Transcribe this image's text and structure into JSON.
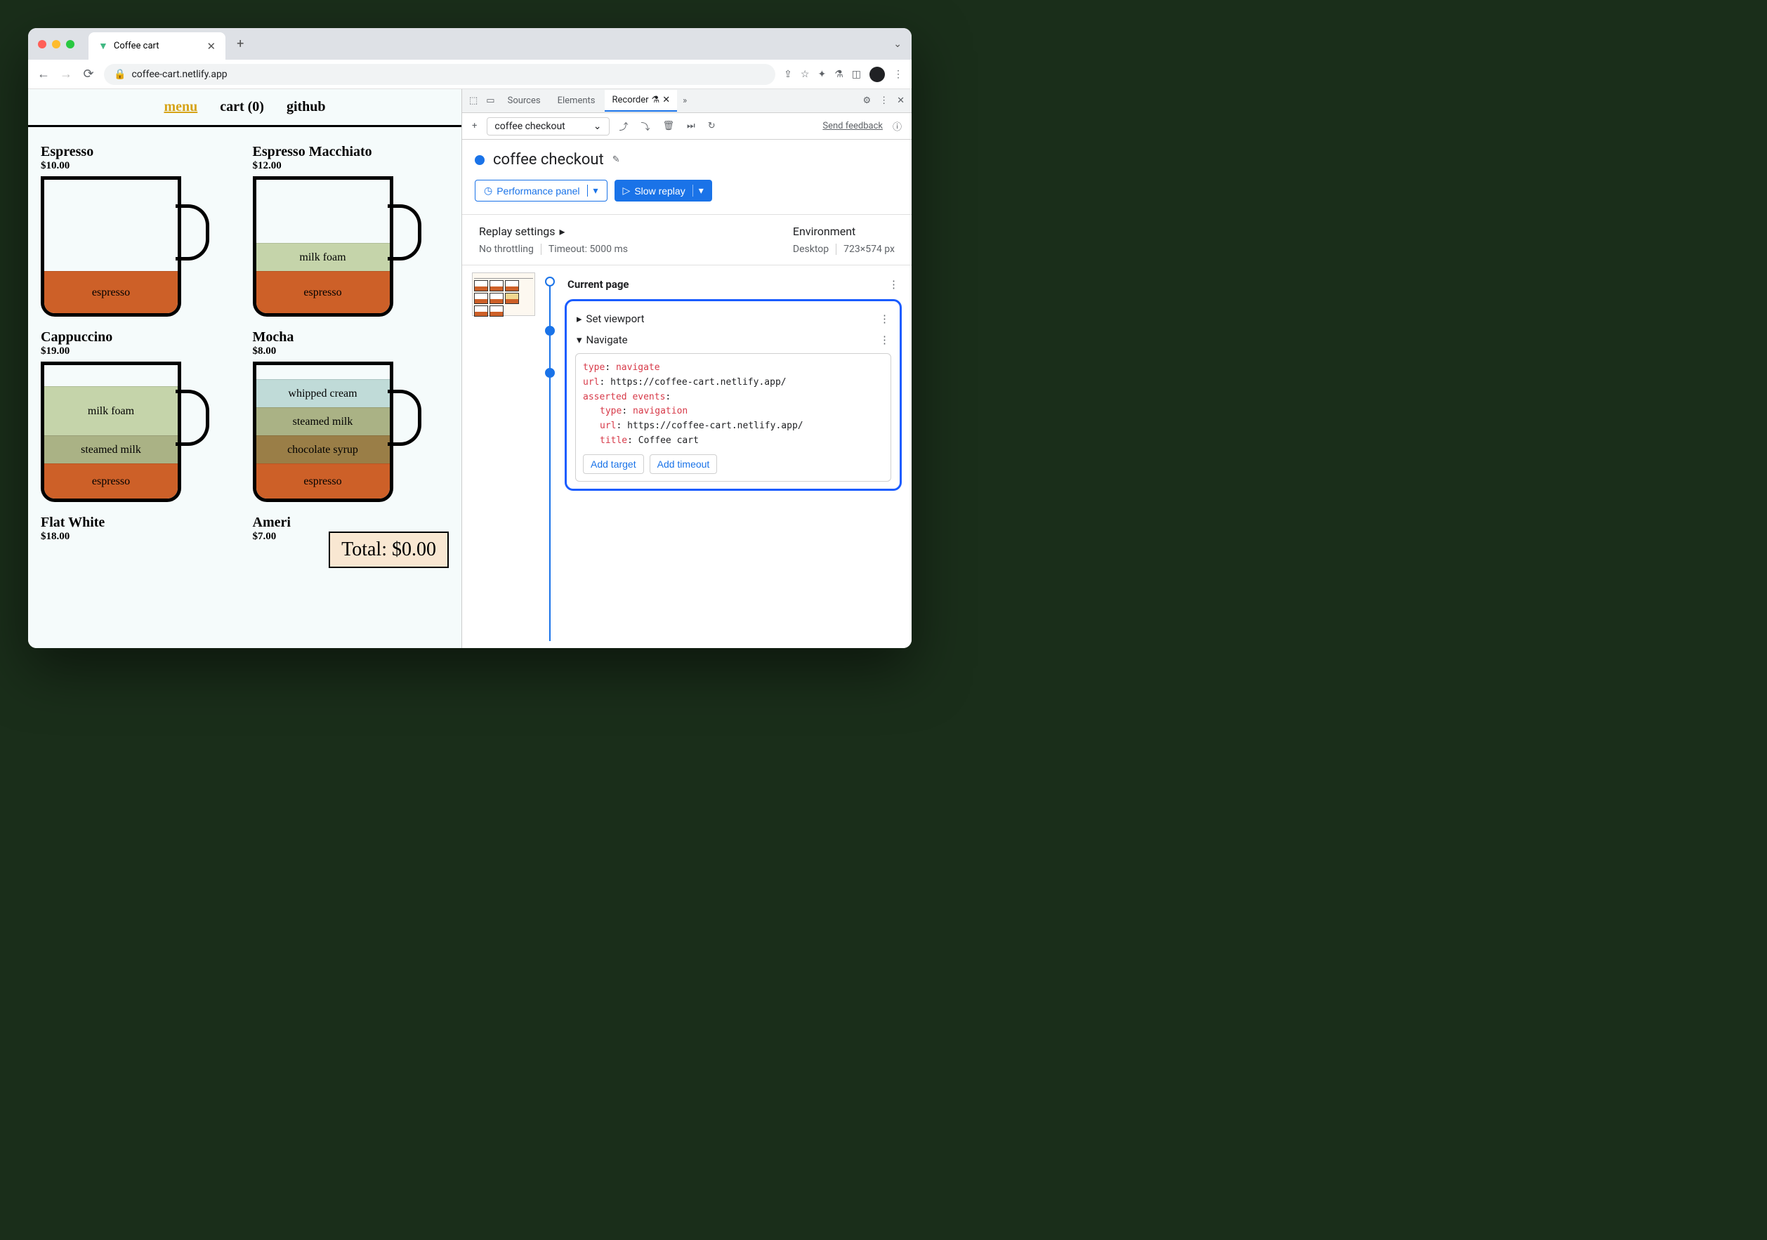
{
  "browser": {
    "tab_title": "Coffee cart",
    "url": "coffee-cart.netlify.app"
  },
  "page": {
    "nav": {
      "menu": "menu",
      "cart": "cart (0)",
      "github": "github"
    },
    "products": [
      {
        "name": "Espresso",
        "price": "$10.00"
      },
      {
        "name": "Espresso Macchiato",
        "price": "$12.00"
      },
      {
        "name": "Cappuccino",
        "price": "$19.00"
      },
      {
        "name": "Mocha",
        "price": "$8.00"
      },
      {
        "name": "Flat White",
        "price": "$18.00"
      },
      {
        "name": "Americano",
        "price": "$7.00"
      }
    ],
    "layers": {
      "espresso": "espresso",
      "milkfoam": "milk foam",
      "steamed": "steamed milk",
      "choc": "chocolate syrup",
      "whip": "whipped cream"
    },
    "total": "Total: $0.00"
  },
  "devtools": {
    "tabs": {
      "sources": "Sources",
      "elements": "Elements",
      "recorder": "Recorder"
    },
    "recorder": {
      "dropdown": "coffee checkout",
      "feedback": "Send feedback",
      "title": "coffee checkout",
      "perf_btn": "Performance panel",
      "replay_btn": "Slow replay",
      "settings": {
        "replay_h": "Replay settings",
        "env_h": "Environment",
        "throttle": "No throttling",
        "timeout": "Timeout: 5000 ms",
        "env_type": "Desktop",
        "viewport": "723×574 px"
      },
      "steps": {
        "current": "Current page",
        "set_viewport": "Set viewport",
        "navigate": "Navigate",
        "code": {
          "type_k": "type",
          "type_v": "navigate",
          "url_k": "url",
          "url_v": "https://coffee-cart.netlify.app/",
          "asserted_k": "asserted events",
          "nav_type_v": "navigation",
          "title_k": "title",
          "title_v": "Coffee cart"
        },
        "add_target": "Add target",
        "add_timeout": "Add timeout"
      }
    }
  }
}
